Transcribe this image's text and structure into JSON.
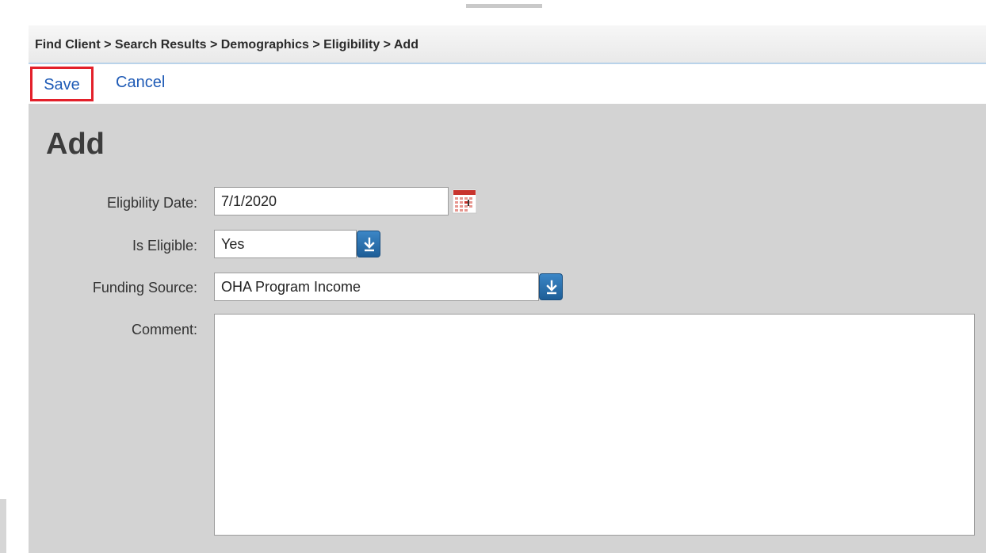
{
  "breadcrumb": "Find Client > Search Results > Demographics > Eligibility > Add",
  "toolbar": {
    "save_label": "Save",
    "cancel_label": "Cancel"
  },
  "page_title": "Add",
  "form": {
    "eligibility_date": {
      "label": "Eligbility Date:",
      "value": "7/1/2020"
    },
    "is_eligible": {
      "label": "Is Eligible:",
      "value": "Yes"
    },
    "funding_source": {
      "label": "Funding Source:",
      "value": "OHA Program Income"
    },
    "comment": {
      "label": "Comment:",
      "value": ""
    }
  },
  "colors": {
    "link": "#1f5bb6",
    "highlight_border": "#e3202a",
    "panel_bg": "#d3d3d3",
    "dropdown_button": "#2a6fae"
  },
  "icons": {
    "calendar": "calendar-icon",
    "dropdown": "download-arrow-icon"
  }
}
